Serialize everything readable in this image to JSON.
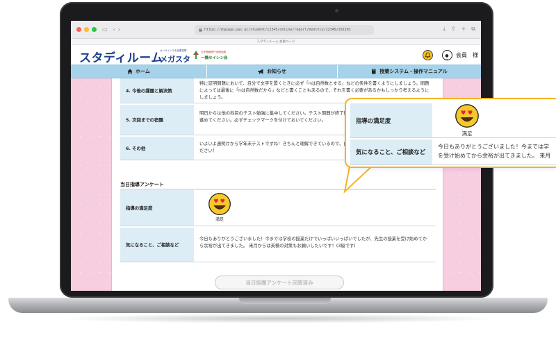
{
  "browser": {
    "url": "https://mypage.pas.ac/student/12345/online/report/monthly/12345/202201",
    "tab_title": "スタディルーム 会員ページ"
  },
  "site": {
    "logo": "スタディルーム",
    "brand_tagline": "オンラインでも効果抜群",
    "brand_name": "メガスタ",
    "partner_tagline": "大学受験専門 個別指導",
    "partner_name": "一橋セイシン会",
    "user_label": "会員　様"
  },
  "nav": {
    "items": [
      {
        "label": "ホーム",
        "icon": "home-icon"
      },
      {
        "label": "お知らせ",
        "icon": "megaphone-icon"
      },
      {
        "label": "授業システム・操作マニュアル",
        "icon": "book-icon"
      }
    ]
  },
  "report": {
    "rows": [
      {
        "label": "4. 今後の課題と解決策",
        "value": "特に証明問題において、自分で文字を置くときに必ず「nは自然数とする」などの条件を書くようにしましょう。問題によっては最後に「nは自然数だから」などと書くこともあるので、それを書く必要があるかもしっかり考えるようにしましょう。"
      },
      {
        "label": "5. 次回までの宿題",
        "value": "明日からは他の科目のテスト勉強に集中してください。テスト期間が終了後は、数学ワークの2章を毎日1ページずつ進めてください。必ずチェックマークを付けておいてください。"
      },
      {
        "label": "6. その他",
        "value": "いよいよ週明けから学年末テストですね！きちんと理解できているので、自信をもって受けてください！"
      }
    ]
  },
  "survey": {
    "title": "当日指導アンケート",
    "satisfaction_label": "指導の満足度",
    "satisfaction_value": "満足",
    "comment_label": "気になること、ご相談など",
    "comment_value": "今日もありがとうございました！今までは学校の授業だけでいっぱいいっぱいでしたが、先生の授業を受け始めてから余裕が出てきました。 来月からは英検の対策もお願いしたいです！(3級です)",
    "done_button": "当日指導アンケート回答済み"
  },
  "callout": {
    "satisfaction_label": "指導の満足度",
    "satisfaction_value": "満足",
    "comment_label": "気になること、ご相談など",
    "comment_line1": "今日もありがとうございました！今までは学",
    "comment_line2": "を受け始めてから余裕が出てきました。 来月"
  },
  "colors": {
    "brand_blue": "#1d3f8e",
    "nav_blue": "#a6d2ea",
    "label_bg": "#dcedf6",
    "pink_bg": "#f7cde0",
    "callout_border": "#f5b21f",
    "emoji_yellow": "#f7c928",
    "heart_red": "#e8203a"
  }
}
